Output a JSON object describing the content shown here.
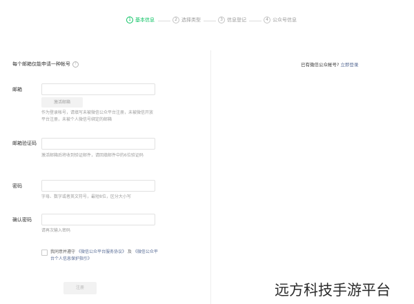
{
  "steps": [
    {
      "num": "1",
      "label": "基本信息"
    },
    {
      "num": "2",
      "label": "选择类型"
    },
    {
      "num": "3",
      "label": "信息登记"
    },
    {
      "num": "4",
      "label": "公众号信息"
    }
  ],
  "form": {
    "header": "每个邮箱仅能申请一种帐号",
    "help_icon": "?",
    "email": {
      "label": "邮箱",
      "value": "",
      "activate_button": "激活邮箱",
      "hint": "作为登录帐号，请填写未被微信公众平台注册，未被微信开放平台注册，未被个人微信号绑定的邮箱"
    },
    "code": {
      "label": "邮箱验证码",
      "value": "",
      "hint": "激活邮箱后将收到验证邮件，请回填邮件中的6位验证码"
    },
    "password": {
      "label": "密码",
      "value": "",
      "hint": "字母、数字或者英文符号，最短8位，区分大小写"
    },
    "confirm": {
      "label": "确认密码",
      "value": "",
      "hint": "请再次输入密码"
    },
    "agree": {
      "prefix": "我同意并遵守",
      "link1": "《微信公众平台服务协议》",
      "and": "及",
      "link2": "《微信公众平台个人信息保护指引》"
    },
    "register_button": "注册"
  },
  "right": {
    "text": "已有微信公众帐号?",
    "link": "立即登录"
  },
  "watermark": "远方科技手游平台"
}
